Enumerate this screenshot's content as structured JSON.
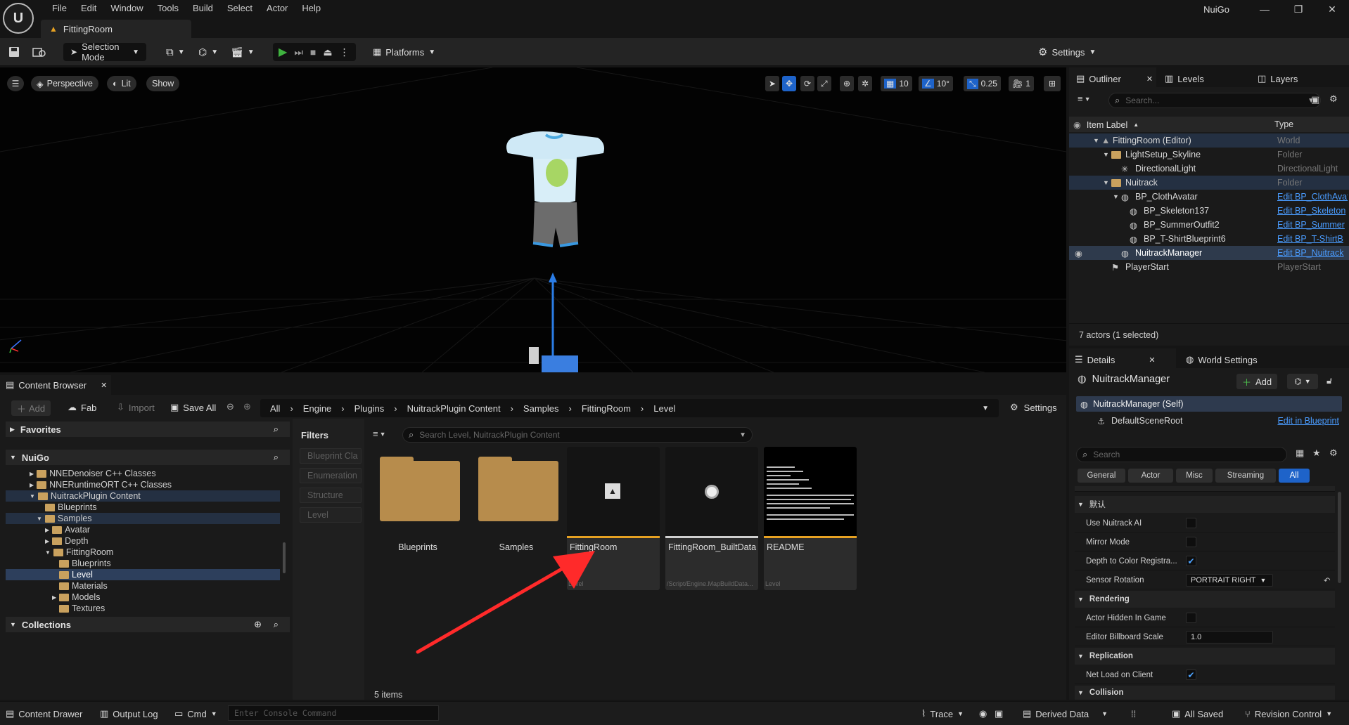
{
  "app_name": "NuiGo",
  "menu": [
    "File",
    "Edit",
    "Window",
    "Tools",
    "Build",
    "Select",
    "Actor",
    "Help"
  ],
  "project_tab": "FittingRoom",
  "toolbar": {
    "selection_mode": "Selection Mode",
    "platforms": "Platforms",
    "settings": "Settings"
  },
  "viewport": {
    "perspective": "Perspective",
    "lit": "Lit",
    "show": "Show",
    "grid_snap": "10",
    "rot_snap": "10°",
    "scale_snap": "0.25",
    "cam_speed": "1"
  },
  "outliner": {
    "tab_outliner": "Outliner",
    "tab_levels": "Levels",
    "tab_layers": "Layers",
    "search_placeholder": "Search...",
    "col_label": "Item Label",
    "col_type": "Type",
    "rows": [
      {
        "label": "FittingRoom (Editor)",
        "type": "World"
      },
      {
        "label": "LightSetup_Skyline",
        "type": "Folder"
      },
      {
        "label": "DirectionalLight",
        "type": "DirectionalLight"
      },
      {
        "label": "Nuitrack",
        "type": "Folder"
      },
      {
        "label": "BP_ClothAvatar",
        "type": "Edit BP_ClothAvatar"
      },
      {
        "label": "BP_Skeleton137",
        "type": "Edit BP_Skeleton"
      },
      {
        "label": "BP_SummerOutfit2",
        "type": "Edit BP_Summer"
      },
      {
        "label": "BP_T-ShirtBlueprint6",
        "type": "Edit BP_T-ShirtB"
      },
      {
        "label": "NuitrackManager",
        "type": "Edit BP_Nuitrack"
      },
      {
        "label": "PlayerStart",
        "type": "PlayerStart"
      }
    ],
    "status": "7 actors (1 selected)"
  },
  "details": {
    "tab_details": "Details",
    "tab_world": "World Settings",
    "actor_name": "NuitrackManager",
    "add_label": "Add",
    "self_label": "NuitrackManager (Self)",
    "root_label": "DefaultSceneRoot",
    "edit_bp": "Edit in Blueprint",
    "search_placeholder": "Search",
    "filter_tabs": [
      "General",
      "Actor",
      "Misc",
      "Streaming",
      "All"
    ],
    "section_default": "默认",
    "props_default": [
      {
        "name": "Use Nuitrack AI",
        "checked": false
      },
      {
        "name": "Mirror Mode",
        "checked": false
      },
      {
        "name": "Depth to Color Registra...",
        "checked": true
      }
    ],
    "sensor_rotation_label": "Sensor Rotation",
    "sensor_rotation_value": "PORTRAIT RIGHT",
    "section_rendering": "Rendering",
    "actor_hidden": "Actor Hidden In Game",
    "billboard_label": "Editor Billboard Scale",
    "billboard_value": "1.0",
    "section_replication": "Replication",
    "net_load": "Net Load on Client",
    "section_collision": "Collision"
  },
  "content_browser": {
    "tab": "Content Browser",
    "add": "Add",
    "fab": "Fab",
    "import": "Import",
    "save_all": "Save All",
    "settings": "Settings",
    "breadcrumb": [
      "All",
      "Engine",
      "Plugins",
      "NuitrackPlugin Content",
      "Samples",
      "FittingRoom",
      "Level"
    ],
    "favorites": "Favorites",
    "root": "NuiGo",
    "tree": [
      {
        "label": "NNEDenoiser C++ Classes"
      },
      {
        "label": "NNERuntimeORT C++ Classes"
      },
      {
        "label": "NuitrackPlugin Content"
      },
      {
        "label": "Blueprints"
      },
      {
        "label": "Samples"
      },
      {
        "label": "Avatar"
      },
      {
        "label": "Depth"
      },
      {
        "label": "FittingRoom"
      },
      {
        "label": "Blueprints"
      },
      {
        "label": "Level"
      },
      {
        "label": "Materials"
      },
      {
        "label": "Models"
      },
      {
        "label": "Textures"
      }
    ],
    "collections": "Collections",
    "filters_title": "Filters",
    "filters": [
      "Blueprint Cla",
      "Enumeration",
      "Structure",
      "Level"
    ],
    "search_placeholder": "Search Level, NuitrackPlugin Content",
    "assets": [
      {
        "name": "Blueprints",
        "kind": "folder",
        "sub": ""
      },
      {
        "name": "Samples",
        "kind": "folder",
        "sub": ""
      },
      {
        "name": "FittingRoom",
        "kind": "level",
        "sub": "Level"
      },
      {
        "name": "FittingRoom_BuiltData",
        "kind": "builtdata",
        "sub": "/Script/Engine.MapBuildData..."
      },
      {
        "name": "README",
        "kind": "readme",
        "sub": "Level"
      }
    ],
    "count": "5 items"
  },
  "statusbar": {
    "content_drawer": "Content Drawer",
    "output_log": "Output Log",
    "cmd": "Cmd",
    "console_placeholder": "Enter Console Command",
    "trace": "Trace",
    "derived_data": "Derived Data",
    "all_saved": "All Saved",
    "revision_control": "Revision Control"
  },
  "colors": {
    "accent": "#1e63c9",
    "play": "#3fb33f",
    "level_bar": "#e6a122",
    "arrow": "#ff2a2a",
    "folder": "#b78c4c"
  }
}
